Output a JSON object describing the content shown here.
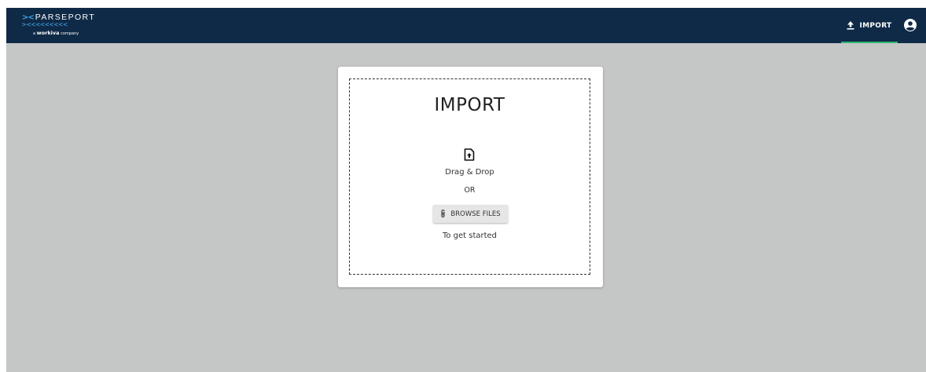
{
  "logo": {
    "arrows": "><",
    "name": "PARSEPORT",
    "chevrons": "><<<<<<<<<",
    "sub_prefix": "a",
    "sub_brand": "workiva",
    "sub_suffix": "company"
  },
  "nav": {
    "import_label": "IMPORT",
    "account_icon": "account-circle-icon",
    "import_icon": "upload-icon"
  },
  "card": {
    "title": "IMPORT",
    "upload_icon": "file-upload-icon",
    "drag_label": "Drag & Drop",
    "or_label": "OR",
    "browse_label": "BROWSE FILES",
    "browse_icon": "paperclip-icon",
    "hint": "To get started"
  },
  "colors": {
    "topbar": "#0f2a47",
    "accent": "#3aa6e8",
    "active_tab": "#2fb673",
    "background": "#c5c7c6"
  }
}
